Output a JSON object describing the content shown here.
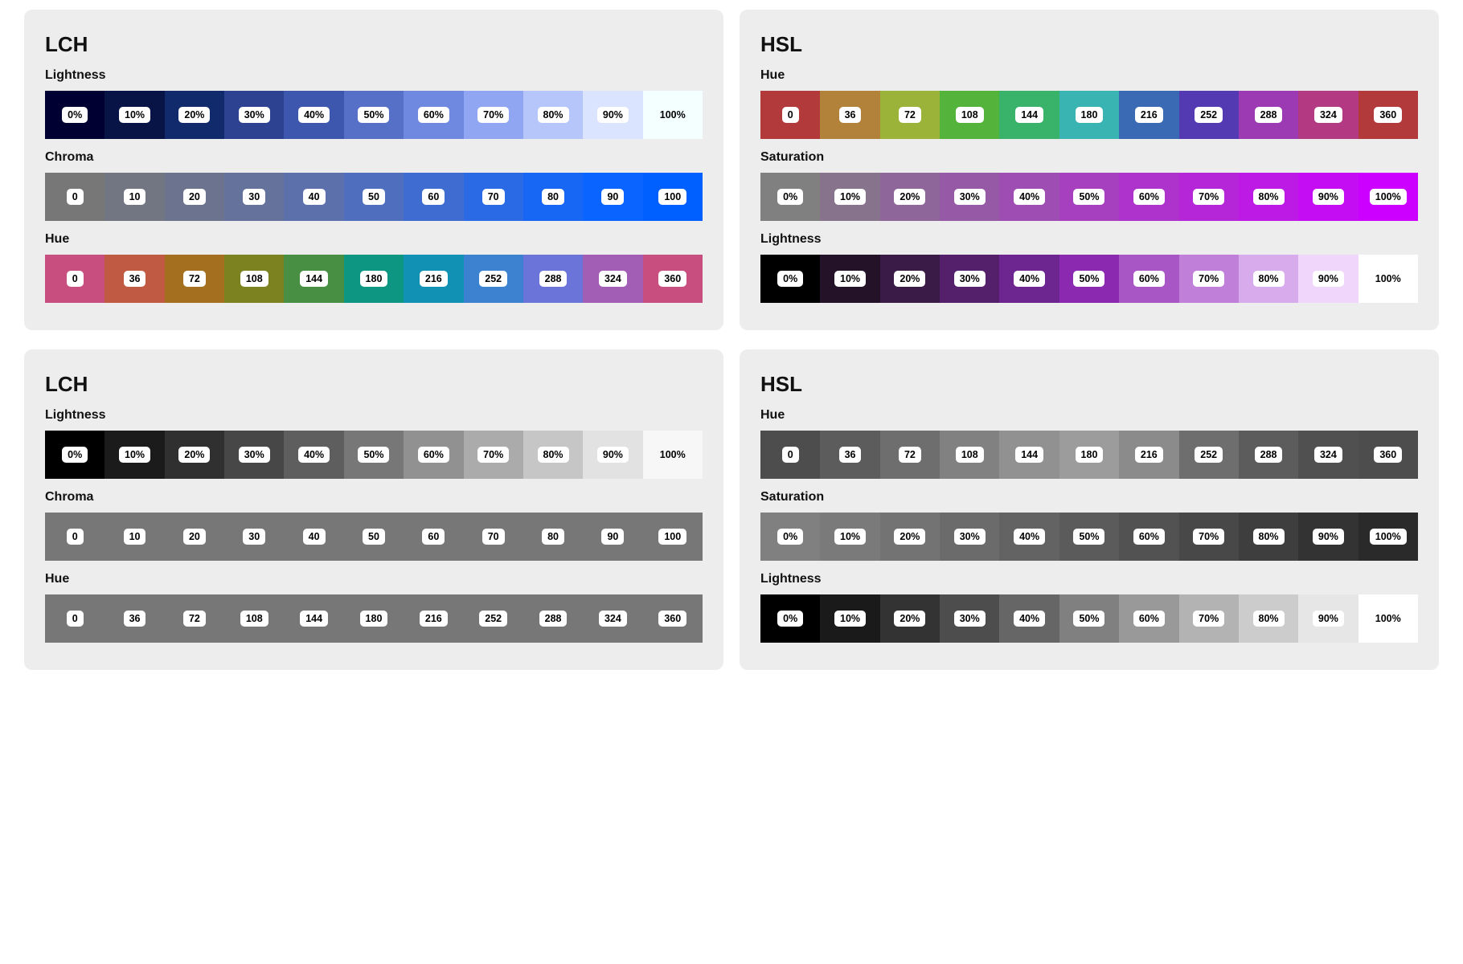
{
  "labels": {
    "lch": "LCH",
    "hsl": "HSL",
    "lightness": "Lightness",
    "chroma": "Chroma",
    "saturation": "Saturation",
    "hue": "Hue"
  },
  "panels": [
    {
      "id": "lch-top",
      "title_key": "lch",
      "rows": [
        {
          "label_key": "lightness",
          "swatches": [
            {
              "label": "0%",
              "bg": "#000033"
            },
            {
              "label": "10%",
              "bg": "#081445"
            },
            {
              "label": "20%",
              "bg": "#102a6b"
            },
            {
              "label": "30%",
              "bg": "#2d4290"
            },
            {
              "label": "40%",
              "bg": "#3d57ae"
            },
            {
              "label": "50%",
              "bg": "#5670c8"
            },
            {
              "label": "60%",
              "bg": "#7089e0"
            },
            {
              "label": "70%",
              "bg": "#90a6f2"
            },
            {
              "label": "80%",
              "bg": "#b6c6fb"
            },
            {
              "label": "90%",
              "bg": "#dbe4fe"
            },
            {
              "label": "100%",
              "bg": "#f4ffff",
              "plain": true
            }
          ]
        },
        {
          "label_key": "chroma",
          "swatches": [
            {
              "label": "0",
              "bg": "#777777"
            },
            {
              "label": "10",
              "bg": "#727582"
            },
            {
              "label": "20",
              "bg": "#6c738e"
            },
            {
              "label": "30",
              "bg": "#65729c"
            },
            {
              "label": "40",
              "bg": "#5c70ac"
            },
            {
              "label": "50",
              "bg": "#4f6ebd"
            },
            {
              "label": "60",
              "bg": "#3f6cd0"
            },
            {
              "label": "70",
              "bg": "#2a6ae4"
            },
            {
              "label": "80",
              "bg": "#1867f4"
            },
            {
              "label": "90",
              "bg": "#0a64ff"
            },
            {
              "label": "100",
              "bg": "#0060ff"
            }
          ]
        },
        {
          "label_key": "hue",
          "swatches": [
            {
              "label": "0",
              "bg": "#c94e80"
            },
            {
              "label": "36",
              "bg": "#c15a43"
            },
            {
              "label": "72",
              "bg": "#a46f1e"
            },
            {
              "label": "108",
              "bg": "#7c8220"
            },
            {
              "label": "144",
              "bg": "#488f44"
            },
            {
              "label": "180",
              "bg": "#0d9682"
            },
            {
              "label": "216",
              "bg": "#1191b4"
            },
            {
              "label": "252",
              "bg": "#3c82d0"
            },
            {
              "label": "288",
              "bg": "#6b74d8"
            },
            {
              "label": "324",
              "bg": "#a25db5"
            },
            {
              "label": "360",
              "bg": "#c94e80"
            }
          ]
        }
      ]
    },
    {
      "id": "hsl-top",
      "title_key": "hsl",
      "rows": [
        {
          "label_key": "hue",
          "swatches": [
            {
              "label": "0",
              "bg": "#b33a3a"
            },
            {
              "label": "36",
              "bg": "#b3823a"
            },
            {
              "label": "72",
              "bg": "#9cb33a"
            },
            {
              "label": "108",
              "bg": "#53b33a"
            },
            {
              "label": "144",
              "bg": "#3ab36a"
            },
            {
              "label": "180",
              "bg": "#3ab3b3"
            },
            {
              "label": "216",
              "bg": "#3a6ab3"
            },
            {
              "label": "252",
              "bg": "#533ab3"
            },
            {
              "label": "288",
              "bg": "#9c3ab3"
            },
            {
              "label": "324",
              "bg": "#b33a82"
            },
            {
              "label": "360",
              "bg": "#b33a3a"
            }
          ]
        },
        {
          "label_key": "saturation",
          "swatches": [
            {
              "label": "0%",
              "bg": "#808080"
            },
            {
              "label": "10%",
              "bg": "#87738c"
            },
            {
              "label": "20%",
              "bg": "#8f6699"
            },
            {
              "label": "30%",
              "bg": "#9659a6"
            },
            {
              "label": "40%",
              "bg": "#9e4db3"
            },
            {
              "label": "50%",
              "bg": "#a640bf"
            },
            {
              "label": "60%",
              "bg": "#ad33cc"
            },
            {
              "label": "70%",
              "bg": "#b526d9"
            },
            {
              "label": "80%",
              "bg": "#bd1ae6"
            },
            {
              "label": "90%",
              "bg": "#c40df2"
            },
            {
              "label": "100%",
              "bg": "#cc00ff"
            }
          ]
        },
        {
          "label_key": "lightness",
          "swatches": [
            {
              "label": "0%",
              "bg": "#000000"
            },
            {
              "label": "10%",
              "bg": "#241229"
            },
            {
              "label": "20%",
              "bg": "#3a1b47"
            },
            {
              "label": "30%",
              "bg": "#55206b"
            },
            {
              "label": "40%",
              "bg": "#6d258f"
            },
            {
              "label": "50%",
              "bg": "#8b2ab1"
            },
            {
              "label": "60%",
              "bg": "#a855c6"
            },
            {
              "label": "70%",
              "bg": "#c080da"
            },
            {
              "label": "80%",
              "bg": "#d8abec"
            },
            {
              "label": "90%",
              "bg": "#efd6fa"
            },
            {
              "label": "100%",
              "bg": "#ffffff",
              "plain": true
            }
          ]
        }
      ]
    },
    {
      "id": "lch-gray",
      "title_key": "lch",
      "rows": [
        {
          "label_key": "lightness",
          "swatches": [
            {
              "label": "0%",
              "bg": "#000000"
            },
            {
              "label": "10%",
              "bg": "#1b1b1b"
            },
            {
              "label": "20%",
              "bg": "#303030"
            },
            {
              "label": "30%",
              "bg": "#474747"
            },
            {
              "label": "40%",
              "bg": "#5e5e5e"
            },
            {
              "label": "50%",
              "bg": "#777777"
            },
            {
              "label": "60%",
              "bg": "#919191"
            },
            {
              "label": "70%",
              "bg": "#ababab"
            },
            {
              "label": "80%",
              "bg": "#c6c6c6"
            },
            {
              "label": "90%",
              "bg": "#e2e2e2"
            },
            {
              "label": "100%",
              "bg": "#f7f7f7",
              "plain": true
            }
          ]
        },
        {
          "label_key": "chroma",
          "swatches": [
            {
              "label": "0",
              "bg": "#777777"
            },
            {
              "label": "10",
              "bg": "#777777"
            },
            {
              "label": "20",
              "bg": "#777777"
            },
            {
              "label": "30",
              "bg": "#777777"
            },
            {
              "label": "40",
              "bg": "#777777"
            },
            {
              "label": "50",
              "bg": "#777777"
            },
            {
              "label": "60",
              "bg": "#777777"
            },
            {
              "label": "70",
              "bg": "#777777"
            },
            {
              "label": "80",
              "bg": "#777777"
            },
            {
              "label": "90",
              "bg": "#777777"
            },
            {
              "label": "100",
              "bg": "#777777"
            }
          ]
        },
        {
          "label_key": "hue",
          "swatches": [
            {
              "label": "0",
              "bg": "#777777"
            },
            {
              "label": "36",
              "bg": "#777777"
            },
            {
              "label": "72",
              "bg": "#777777"
            },
            {
              "label": "108",
              "bg": "#777777"
            },
            {
              "label": "144",
              "bg": "#777777"
            },
            {
              "label": "180",
              "bg": "#777777"
            },
            {
              "label": "216",
              "bg": "#777777"
            },
            {
              "label": "252",
              "bg": "#777777"
            },
            {
              "label": "288",
              "bg": "#777777"
            },
            {
              "label": "324",
              "bg": "#777777"
            },
            {
              "label": "360",
              "bg": "#777777"
            }
          ]
        }
      ]
    },
    {
      "id": "hsl-gray",
      "title_key": "hsl",
      "rows": [
        {
          "label_key": "hue",
          "swatches": [
            {
              "label": "0",
              "bg": "#4d4d4d"
            },
            {
              "label": "36",
              "bg": "#5c5c5c"
            },
            {
              "label": "72",
              "bg": "#6e6e6e"
            },
            {
              "label": "108",
              "bg": "#818181"
            },
            {
              "label": "144",
              "bg": "#919191"
            },
            {
              "label": "180",
              "bg": "#9c9c9c"
            },
            {
              "label": "216",
              "bg": "#8b8b8b"
            },
            {
              "label": "252",
              "bg": "#6e6e6e"
            },
            {
              "label": "288",
              "bg": "#5c5c5c"
            },
            {
              "label": "324",
              "bg": "#505050"
            },
            {
              "label": "360",
              "bg": "#4d4d4d"
            }
          ]
        },
        {
          "label_key": "saturation",
          "swatches": [
            {
              "label": "0%",
              "bg": "#808080"
            },
            {
              "label": "10%",
              "bg": "#7a7a7a"
            },
            {
              "label": "20%",
              "bg": "#737373"
            },
            {
              "label": "30%",
              "bg": "#6b6b6b"
            },
            {
              "label": "40%",
              "bg": "#636363"
            },
            {
              "label": "50%",
              "bg": "#5b5b5b"
            },
            {
              "label": "60%",
              "bg": "#525252"
            },
            {
              "label": "70%",
              "bg": "#484848"
            },
            {
              "label": "80%",
              "bg": "#3e3e3e"
            },
            {
              "label": "90%",
              "bg": "#333333"
            },
            {
              "label": "100%",
              "bg": "#2a2a2a"
            }
          ]
        },
        {
          "label_key": "lightness",
          "swatches": [
            {
              "label": "0%",
              "bg": "#000000"
            },
            {
              "label": "10%",
              "bg": "#1a1a1a"
            },
            {
              "label": "20%",
              "bg": "#333333"
            },
            {
              "label": "30%",
              "bg": "#4d4d4d"
            },
            {
              "label": "40%",
              "bg": "#666666"
            },
            {
              "label": "50%",
              "bg": "#808080"
            },
            {
              "label": "60%",
              "bg": "#999999"
            },
            {
              "label": "70%",
              "bg": "#b3b3b3"
            },
            {
              "label": "80%",
              "bg": "#cccccc"
            },
            {
              "label": "90%",
              "bg": "#e6e6e6"
            },
            {
              "label": "100%",
              "bg": "#ffffff",
              "plain": true
            }
          ]
        }
      ]
    }
  ]
}
